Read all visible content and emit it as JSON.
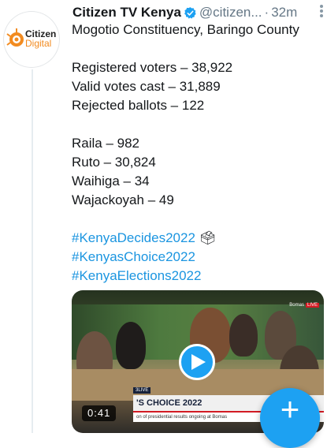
{
  "tweet": {
    "author_name": "Citizen TV Kenya",
    "handle": "@citizen...",
    "separator": "·",
    "time": "32m",
    "avatar": {
      "line1": "Citizen",
      "line2": "Digital"
    },
    "verified_icon": "verified-badge-icon",
    "more_icon": "more-vertical-icon",
    "location": "Mogotio  Constituency, Baringo County",
    "stats": [
      "Registered voters – 38,922",
      "Valid votes cast – 31,889",
      "Rejected ballots – 122"
    ],
    "results": [
      "Raila – 982",
      "Ruto – 30,824",
      "Waihiga – 34",
      "Wajackoyah – 49"
    ],
    "hashtags": [
      "#KenyaDecides2022",
      "#KenyasChoice2022",
      "#KenyaElections2022"
    ],
    "hashtag_emoji": "🗳",
    "media": {
      "duration": "0:41",
      "play_icon": "play-icon",
      "banner_title": "'S CHOICE 2022",
      "banner_sub": "on of presidential results ongoing at Bomas",
      "banner_code": "3LIVE",
      "corner_logo": "Bomas",
      "corner_live": "LIVE"
    }
  },
  "compose_button": {
    "label": "+",
    "icon": "plus-icon"
  },
  "colors": {
    "accent": "#1da1f2",
    "hashtag": "#1b95e0",
    "muted": "#657786",
    "brand_orange": "#f28b20"
  }
}
